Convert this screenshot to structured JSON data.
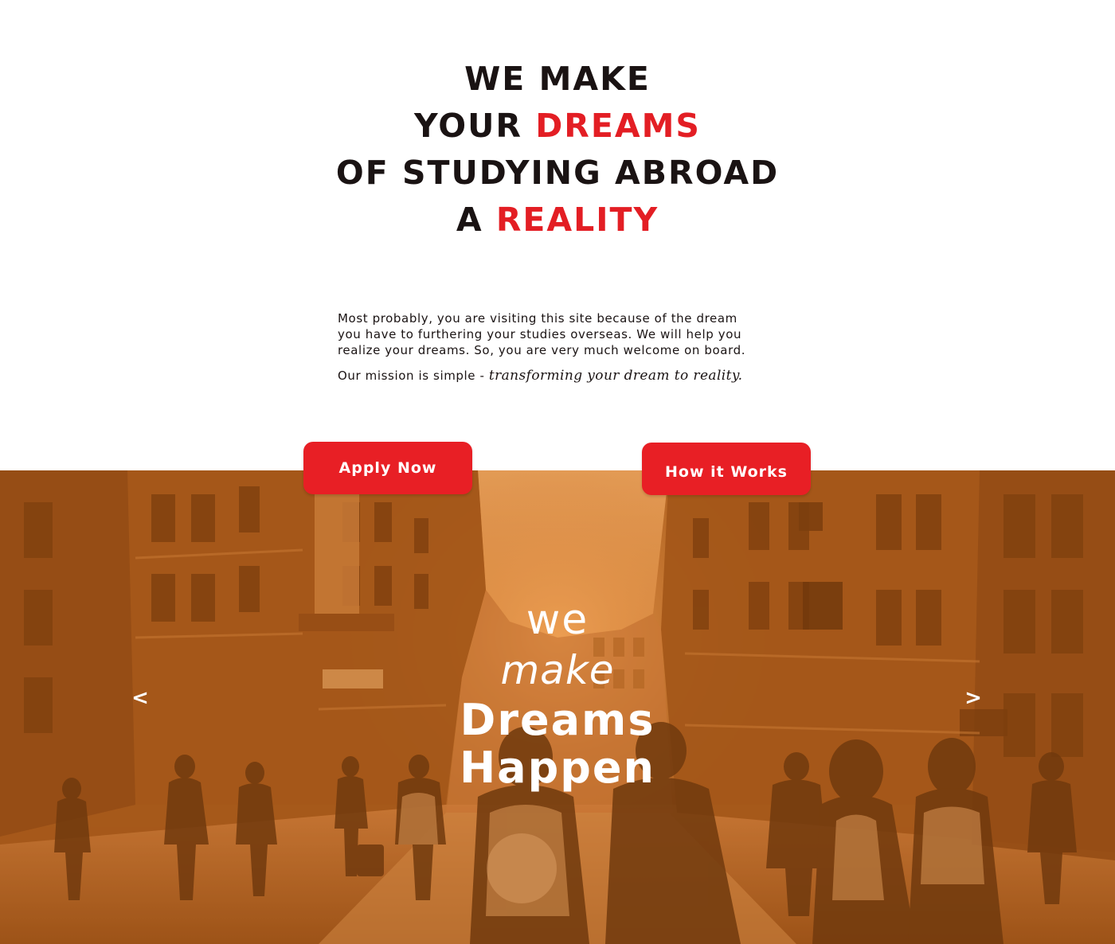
{
  "headline": {
    "line1": "WE MAKE",
    "line2_prefix": "YOUR ",
    "line2_highlight": "DREAMS",
    "line3": "OF STUDYING ABROAD",
    "line4_prefix": "A ",
    "line4_highlight": "REALITY"
  },
  "intro": {
    "paragraph_line1": "Most probably, you are visiting this site because of the dream",
    "paragraph_line2": "you have to furthering your studies overseas. We will help you",
    "paragraph_line3": "realize your dreams. So, you are very much welcome on board.",
    "mission_prefix": "Our mission is simple - ",
    "mission_emphasis": "transforming your dream to reality."
  },
  "buttons": {
    "apply_label": "Apply Now",
    "how_label": "How it Works"
  },
  "banner": {
    "tagline_we": "we",
    "tagline_make": "make",
    "tagline_dreams": "Dreams",
    "tagline_happen": "Happen",
    "prev_arrow": "<",
    "next_arrow": ">",
    "prev_icon": "chevron-left-icon",
    "next_icon": "chevron-right-icon"
  },
  "colors": {
    "accent_red": "#e31e24",
    "button_red": "#e81f25",
    "heading_text": "#1a1313",
    "banner_tint": "#c06a22",
    "banner_highlight": "#f7b56c"
  }
}
